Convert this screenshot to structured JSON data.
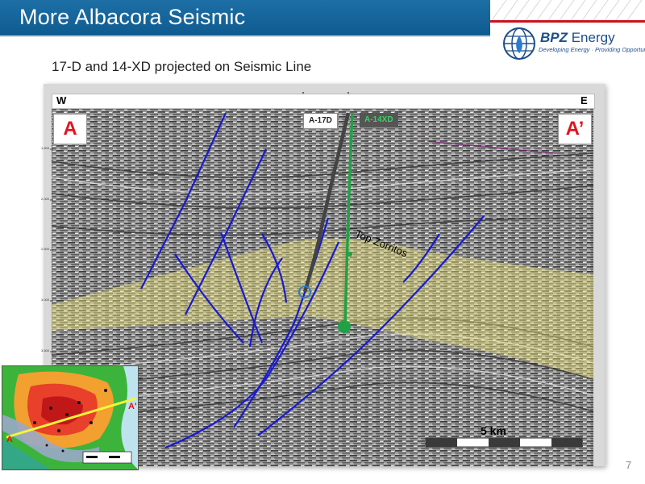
{
  "slide": {
    "title": "More Albacora Seismic",
    "subtitle": "17-D and 14-XD projected on Seismic Line",
    "page_number": "7"
  },
  "logo": {
    "name_bold": "BPZ",
    "name_rest": " Energy",
    "tagline": "Developing Energy · Providing Opportunities"
  },
  "section": {
    "west_label": "W",
    "east_label": "E",
    "start_label": "A",
    "end_label": "A’",
    "horizon_label": "Top Zorritos",
    "depth_ticks": [
      "1,500",
      "2,000",
      "2,500",
      "3,000",
      "3,500"
    ],
    "wells": [
      {
        "name": "A-17D",
        "color": "#333333"
      },
      {
        "name": "A-14XD",
        "color": "#22a046"
      }
    ]
  },
  "inset_map": {
    "start_label": "A",
    "end_label": "A'"
  },
  "scale_bar": {
    "label": "5 km"
  },
  "colors": {
    "title_bar": "#1d6fa6",
    "accent_red": "#c8141e",
    "fault_blue": "#1a1ad0",
    "well_green": "#22a046",
    "zone_yellow": "#f2ea78"
  }
}
